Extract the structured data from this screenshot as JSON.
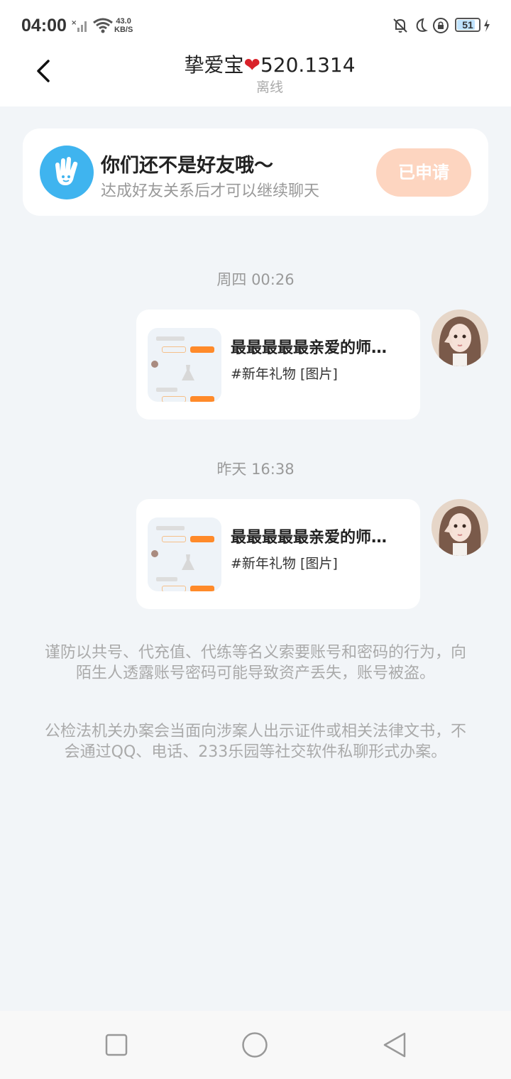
{
  "status_bar": {
    "time": "04:00",
    "net_speed_value": "43.0",
    "net_speed_unit": "KB/S",
    "battery": "51"
  },
  "header": {
    "title_prefix": "挚爱宝",
    "title_heart": "❤",
    "title_suffix": "520.1314",
    "status": "离线"
  },
  "friend_card": {
    "title": "你们还不是好友哦～",
    "subtitle": "达成好友关系后才可以继续聊天",
    "button": "已申请"
  },
  "messages": [
    {
      "time": "周四 00:26",
      "title": "最最最最最亲爱的师…",
      "subtitle": "#新年礼物 [图片]"
    },
    {
      "time": "昨天 16:38",
      "title": "最最最最最亲爱的师…",
      "subtitle": "#新年礼物 [图片]"
    }
  ],
  "notices": {
    "warning_1": "谨防以共号、代充值、代练等名义索要账号和密码的行为，向陌生人透露账号密码可能导致资产丢失，账号被盗。",
    "warning_2": "公检法机关办案会当面向涉案人出示证件或相关法律文书，不会通过QQ、电话、233乐园等社交软件私聊形式办案。"
  },
  "colors": {
    "background": "#f2f5f8",
    "accent_blue": "#3fb4ef",
    "applied_button": "#fdd5c0",
    "heart": "#d9222a"
  }
}
